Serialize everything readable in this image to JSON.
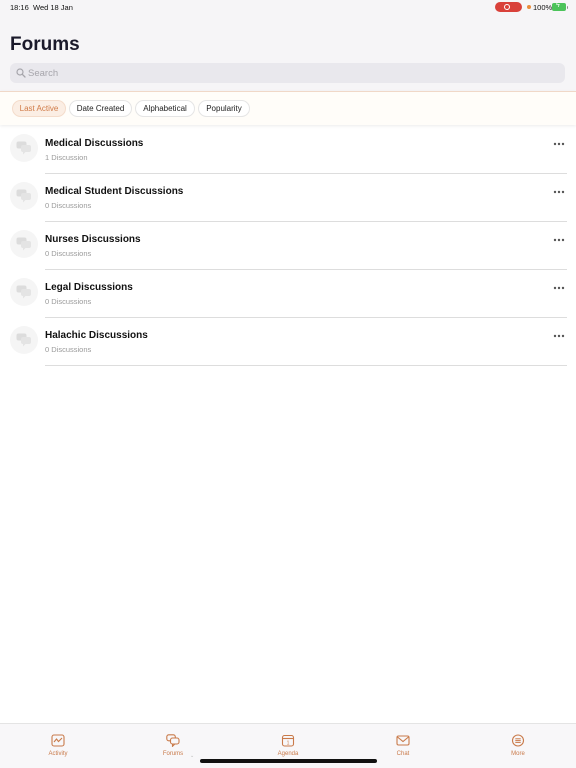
{
  "status_bar": {
    "time": "18:16",
    "date": "Wed 18 Jan",
    "battery": "100%"
  },
  "header": {
    "title": "Forums"
  },
  "search": {
    "placeholder": "Search",
    "value": ""
  },
  "filters": [
    {
      "label": "Last Active",
      "active": true
    },
    {
      "label": "Date Created",
      "active": false
    },
    {
      "label": "Alphabetical",
      "active": false
    },
    {
      "label": "Popularity",
      "active": false
    }
  ],
  "forums": [
    {
      "title": "Medical Discussions",
      "count": "1 Discussion"
    },
    {
      "title": "Medical Student Discussions",
      "count": "0 Discussions"
    },
    {
      "title": "Nurses Discussions",
      "count": "0 Discussions"
    },
    {
      "title": "Legal Discussions",
      "count": "0 Discussions"
    },
    {
      "title": "Halachic Discussions",
      "count": "0 Discussions"
    }
  ],
  "tab_bar": [
    {
      "label": "Activity",
      "icon": "activity-icon"
    },
    {
      "label": "Forums",
      "icon": "forums-icon"
    },
    {
      "label": "Agenda",
      "icon": "calendar-icon"
    },
    {
      "label": "Chat",
      "icon": "envelope-icon"
    },
    {
      "label": "More",
      "icon": "menu-icon"
    }
  ],
  "colors": {
    "accent": "#c97a4a",
    "active_chip_bg": "#fbeee4",
    "header_bg": "#f6f5f7",
    "recording": "#d9413a",
    "battery": "#4cc35a"
  }
}
